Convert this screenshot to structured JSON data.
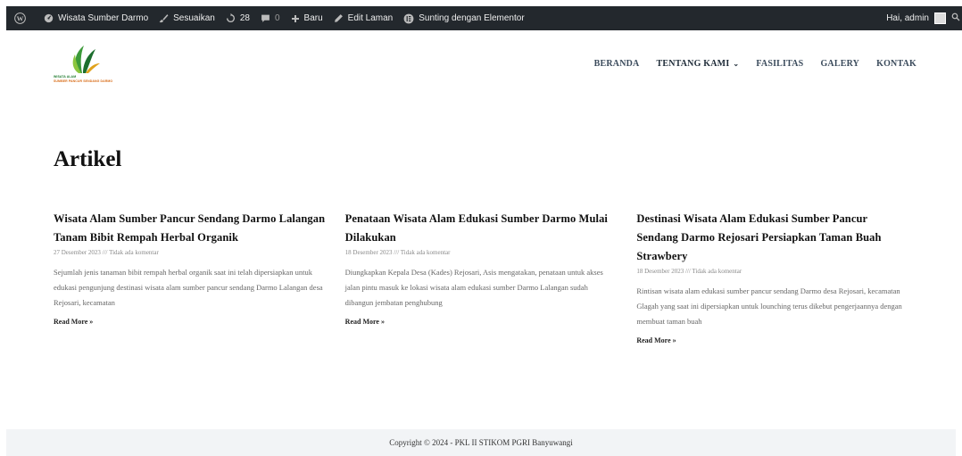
{
  "adminbar": {
    "site_name": "Wisata Sumber Darmo",
    "customize": "Sesuaikan",
    "updates_count": "28",
    "comments_count": "0",
    "new": "Baru",
    "edit_page": "Edit Laman",
    "elementor": "Sunting dengan Elementor",
    "greeting": "Hai, admin",
    "colors": {
      "bar": "#23282d"
    }
  },
  "header": {
    "logo_line1": "WISATA ALAM",
    "logo_line2": "SUMBER PANCUR SENDANG DARMO",
    "nav": [
      {
        "label": "BERANDA"
      },
      {
        "label": "TENTANG KAMI"
      },
      {
        "label": "FASILITAS"
      },
      {
        "label": "GALERY"
      },
      {
        "label": "KONTAK"
      }
    ]
  },
  "page": {
    "title": "Artikel"
  },
  "posts": [
    {
      "title": "Wisata Alam Sumber Pancur Sendang Darmo Lalangan Tanam Bibit Rempah Herbal Organik",
      "meta": "27 Desember 2023 /// Tidak ada komentar",
      "excerpt": "Sejumlah jenis tanaman bibit rempah herbal organik saat ini telah dipersiapkan untuk edukasi pengunjung destinasi wisata alam sumber pancur sendang Darmo Lalangan desa Rejosari, kecamatan",
      "read_more": "Read More »"
    },
    {
      "title": "Penataan Wisata Alam Edukasi Sumber Darmo Mulai Dilakukan",
      "meta": "18 Desember 2023 /// Tidak ada komentar",
      "excerpt": "Diungkapkan Kepala Desa (Kades) Rejosari, Asis mengatakan, penataan untuk akses jalan pintu masuk ke lokasi wisata alam edukasi sumber Darmo Lalangan sudah dibangun jembatan penghubung",
      "read_more": "Read More »"
    },
    {
      "title": "Destinasi Wisata Alam Edukasi Sumber Pancur Sendang Darmo Rejosari Persiapkan Taman Buah Strawbery",
      "meta": "18 Desember 2023 /// Tidak ada komentar",
      "excerpt": "Rintisan wisata alam edukasi sumber pancur sendang Darmo desa Rejosari, kecamatan Glagah yang saat ini dipersiapkan untuk lounching terus dikebut pengerjaannya dengan membuat taman buah",
      "read_more": "Read More »"
    }
  ],
  "footer": {
    "copyright": "Copyright © 2024 - PKL II STIKOM PGRI Banyuwangi"
  },
  "icons": {
    "wp": "wordpress-icon",
    "site": "dashboard-icon",
    "customize": "brush-icon",
    "updates": "refresh-icon",
    "comments": "comment-icon",
    "new": "plus-icon",
    "edit": "pencil-icon",
    "elementor": "elementor-icon",
    "search": "search-icon"
  }
}
